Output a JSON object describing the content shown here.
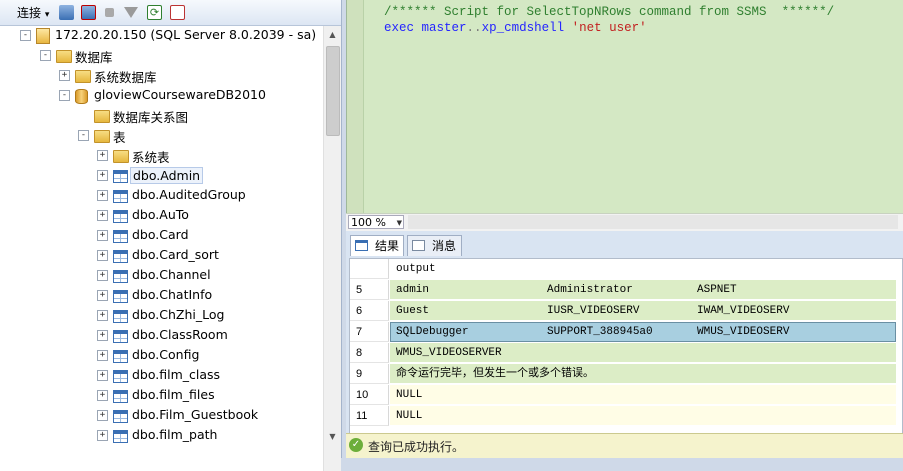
{
  "object_explorer": {
    "toolbar": {
      "connect_label": "连接",
      "dropdown_glyph": "▾"
    },
    "tree": [
      {
        "label": "172.20.20.150 (SQL Server 8.0.2039 - sa)",
        "icon": "server-icon",
        "expander": "-",
        "level": 0
      },
      {
        "label": "数据库",
        "icon": "folder-icon",
        "expander": "-",
        "level": 1
      },
      {
        "label": "系统数据库",
        "icon": "folder-icon",
        "expander": "+",
        "level": 2
      },
      {
        "label": "gloviewCoursewareDB2010",
        "icon": "database-icon",
        "expander": "-",
        "level": 2
      },
      {
        "label": "数据库关系图",
        "icon": "folder-icon",
        "expander": "",
        "level": 3
      },
      {
        "label": "表",
        "icon": "folder-icon",
        "expander": "-",
        "level": 3
      },
      {
        "label": "系统表",
        "icon": "folder-icon",
        "expander": "+",
        "level": 4
      },
      {
        "label": "dbo.Admin",
        "icon": "table-icon",
        "expander": "+",
        "level": 4,
        "selected": true
      },
      {
        "label": "dbo.AuditedGroup",
        "icon": "table-icon",
        "expander": "+",
        "level": 4
      },
      {
        "label": "dbo.AuTo",
        "icon": "table-icon",
        "expander": "+",
        "level": 4
      },
      {
        "label": "dbo.Card",
        "icon": "table-icon",
        "expander": "+",
        "level": 4
      },
      {
        "label": "dbo.Card_sort",
        "icon": "table-icon",
        "expander": "+",
        "level": 4
      },
      {
        "label": "dbo.Channel",
        "icon": "table-icon",
        "expander": "+",
        "level": 4
      },
      {
        "label": "dbo.ChatInfo",
        "icon": "table-icon",
        "expander": "+",
        "level": 4
      },
      {
        "label": "dbo.ChZhi_Log",
        "icon": "table-icon",
        "expander": "+",
        "level": 4
      },
      {
        "label": "dbo.ClassRoom",
        "icon": "table-icon",
        "expander": "+",
        "level": 4
      },
      {
        "label": "dbo.Config",
        "icon": "table-icon",
        "expander": "+",
        "level": 4
      },
      {
        "label": "dbo.film_class",
        "icon": "table-icon",
        "expander": "+",
        "level": 4
      },
      {
        "label": "dbo.film_files",
        "icon": "table-icon",
        "expander": "+",
        "level": 4
      },
      {
        "label": "dbo.Film_Guestbook",
        "icon": "table-icon",
        "expander": "+",
        "level": 4
      },
      {
        "label": "dbo.film_path",
        "icon": "table-icon",
        "expander": "+",
        "level": 4
      }
    ]
  },
  "editor": {
    "line1": "/****** Script for SelectTopNRows command from SSMS  ******/",
    "line2_kw": "exec",
    "line2_obj": "master",
    "line2_dots": "..",
    "line2_proc": "xp_cmdshell",
    "line2_str": "'net user'"
  },
  "zoom": {
    "value": "100 %"
  },
  "results": {
    "tabs": [
      {
        "label": "结果",
        "icon": "grid-icon",
        "active": true
      },
      {
        "label": "消息",
        "icon": "messages-icon",
        "active": false
      }
    ],
    "header": "output",
    "rows": [
      {
        "num": "5",
        "cells": [
          "admin",
          "Administrator",
          "ASPNET"
        ],
        "style": "green"
      },
      {
        "num": "6",
        "cells": [
          "Guest",
          "IUSR_VIDEOSERV",
          "IWAM_VIDEOSERV"
        ],
        "style": "green"
      },
      {
        "num": "7",
        "cells": [
          "SQLDebugger",
          "SUPPORT_388945a0",
          "WMUS_VIDEOSERV"
        ],
        "style": "blue"
      },
      {
        "num": "8",
        "cells": [
          "WMUS_VIDEOSERVER",
          "",
          ""
        ],
        "style": "green"
      },
      {
        "num": "9",
        "cells": [
          "命令运行完毕，但发生一个或多个错误。",
          "",
          ""
        ],
        "style": "green"
      },
      {
        "num": "10",
        "cells": [
          "NULL",
          "",
          ""
        ],
        "style": "yellow"
      },
      {
        "num": "11",
        "cells": [
          "NULL",
          "",
          ""
        ],
        "style": "yellow"
      }
    ]
  },
  "status": {
    "message": "查询已成功执行。"
  }
}
